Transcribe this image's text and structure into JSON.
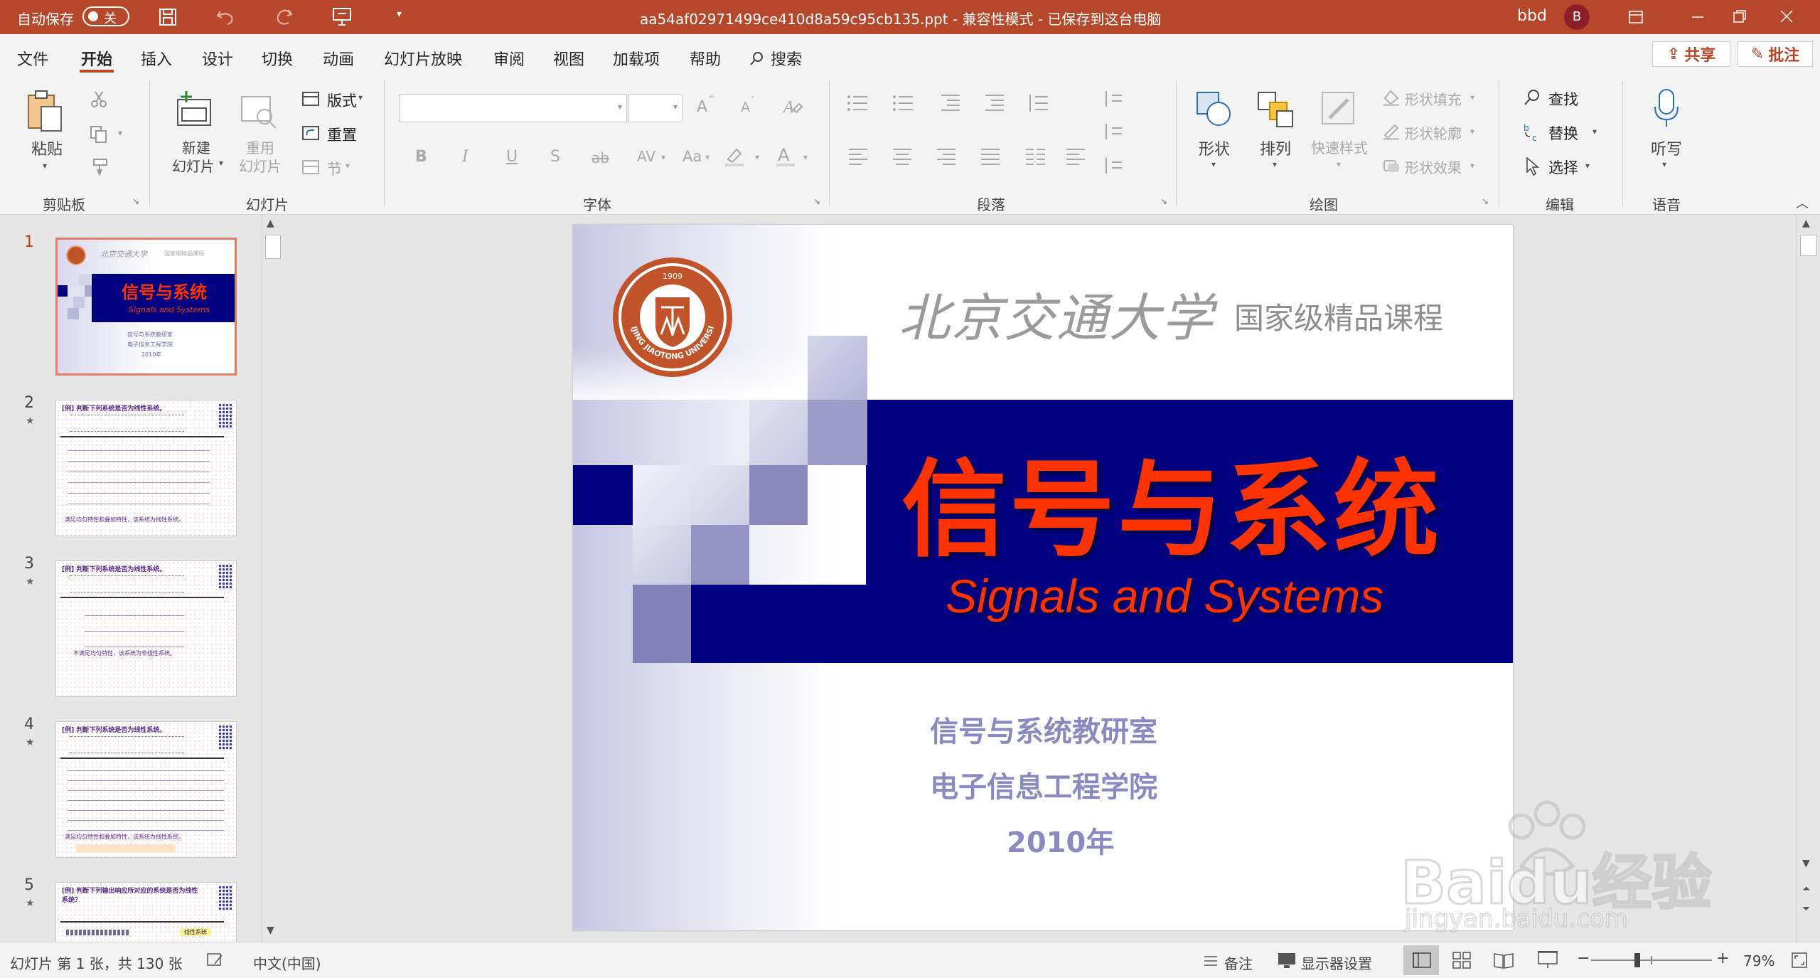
{
  "titlebar": {
    "autosave_label": "自动保存",
    "autosave_state": "关",
    "document_title": "aa54af02971499ce410d8a59c95cb135.ppt  -  兼容性模式  -  已保存到这台电脑",
    "user_name": "bbd",
    "avatar_initial": "B",
    "color": "#b7472a"
  },
  "menu": {
    "tabs": [
      "文件",
      "开始",
      "插入",
      "设计",
      "切换",
      "动画",
      "幻灯片放映",
      "审阅",
      "视图",
      "加载项",
      "帮助"
    ],
    "search_label": "搜索",
    "share_label": "共享",
    "comment_label": "批注",
    "active_tab": "开始"
  },
  "ribbon": {
    "clipboard": {
      "paste": "粘贴",
      "group": "剪贴板"
    },
    "slides": {
      "new_slide_1": "新建",
      "new_slide_2": "幻灯片",
      "reuse_1": "重用",
      "reuse_2": "幻灯片",
      "layout": "版式",
      "reset": "重置",
      "section": "节",
      "group": "幻灯片"
    },
    "font": {
      "group": "字体",
      "bold": "B",
      "italic": "I",
      "underline": "U",
      "shadow": "S",
      "strike": "ab",
      "spacing": "AV",
      "case": "Aa",
      "grow": "A",
      "shrink": "A"
    },
    "paragraph": {
      "group": "段落"
    },
    "drawing": {
      "shapes": "形状",
      "arrange": "排列",
      "quick_styles": "快速样式",
      "fill": "形状填充",
      "outline": "形状轮廓",
      "effects": "形状效果",
      "group": "绘图"
    },
    "editing": {
      "find": "查找",
      "replace": "替换",
      "select": "选择",
      "group": "编辑"
    },
    "voice": {
      "dictate": "听写",
      "group": "语音"
    }
  },
  "thumbnails": [
    {
      "num": "1",
      "title": "信号与系统",
      "subtitle": "Signals and Systems",
      "lines": [
        "信号与系统教研室",
        "电子信息工程学院",
        "2010年"
      ],
      "header": "国家级精品课程"
    },
    {
      "num": "2",
      "heading": "[例] 判断下列系统是否为线性系统。",
      "conclusion": "满足均匀特性和叠加特性，该系统为线性系统。"
    },
    {
      "num": "3",
      "heading": "[例] 判断下列系统是否为线性系统。",
      "conclusion": "不满足均匀特性，该系统为非线性系统。"
    },
    {
      "num": "4",
      "heading": "[例] 判断下列系统是否为线性系统。",
      "conclusion": "满足均匀特性和叠加特性，该系统为线性系统。"
    },
    {
      "num": "5",
      "heading": "[例] 判断下列输出响应所对应的系统是否为线性系统？",
      "tag": "线性系统"
    }
  ],
  "slide": {
    "university": "北京交通大学",
    "course_tag": "国家级精品课程",
    "title": "信号与系统",
    "subtitle": "Signals and Systems",
    "dept": "信号与系统教研室",
    "school": "电子信息工程学院",
    "year": "2010年",
    "logo_year": "1909",
    "logo_text": "BEIJING JIAOTONG UNIVERSITY",
    "band_color": "#000080",
    "title_color": "#ff3300"
  },
  "watermark": {
    "brand": "Baidu经验",
    "url": "jingyan.baidu.com"
  },
  "status": {
    "slide_info": "幻灯片 第 1 张，共 130 张",
    "language": "中文(中国)",
    "notes": "备注",
    "display_settings": "显示器设置",
    "zoom": "79%",
    "zoom_value": 0.79
  }
}
